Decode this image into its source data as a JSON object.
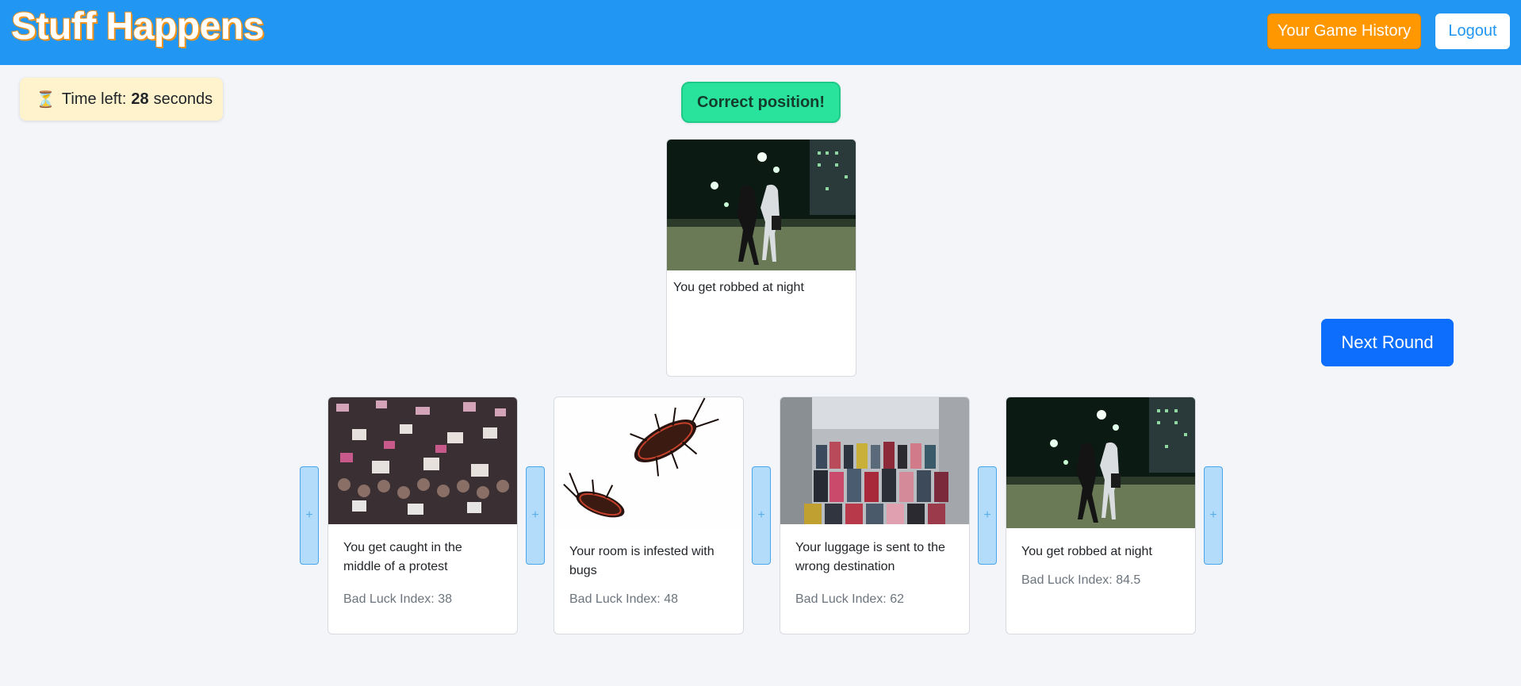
{
  "navbar": {
    "brand": "Stuff Happens",
    "history_label": "Your Game History",
    "logout_label": "Logout",
    "color": "#2196f3"
  },
  "timer": {
    "prefix": "Time left:",
    "seconds": "28",
    "suffix": "seconds",
    "icon": "hourglass-icon"
  },
  "result": {
    "message": "Correct position!"
  },
  "current_card": {
    "caption": "You get robbed at night",
    "image": "night-robbery-photo"
  },
  "next_round_label": "Next Round",
  "insert_slot_label": "+",
  "hand": [
    {
      "caption": "You get caught in the middle of a protest",
      "index_label": "Bad Luck Index: 38",
      "image": "protest-crowd-photo"
    },
    {
      "caption": "Your room is infested with bugs",
      "index_label": "Bad Luck Index: 48",
      "image": "bugs-photo"
    },
    {
      "caption": "Your luggage is sent to the wrong destination",
      "index_label": "Bad Luck Index: 62",
      "image": "luggage-photo"
    },
    {
      "caption": "You get robbed at night",
      "index_label": "Bad Luck Index: 84.5",
      "image": "night-robbery-photo"
    }
  ]
}
